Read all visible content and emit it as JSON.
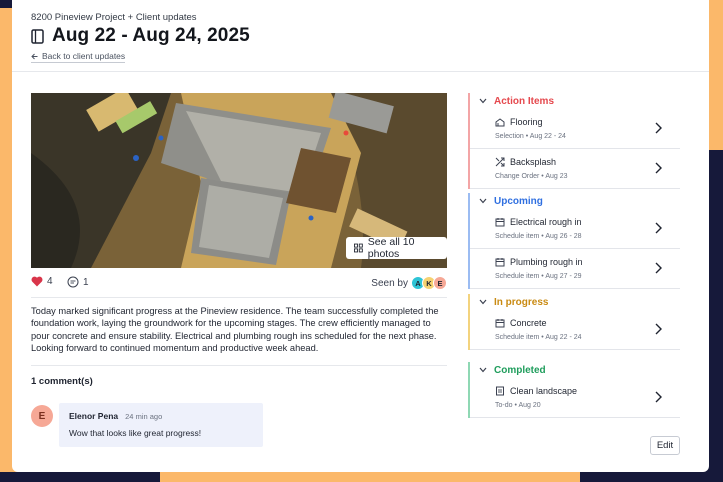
{
  "header": {
    "breadcrumb": "8200 Pineview Project + Client updates",
    "title": "Aug 22 - Aug 24, 2025",
    "back_link": "Back to client updates"
  },
  "photo": {
    "see_all_label": "See all 10 photos"
  },
  "reactions": {
    "likes": "4",
    "comments": "1",
    "seen_by_label": "Seen by",
    "avatars": [
      "A",
      "K",
      "E"
    ],
    "avatar_colors": [
      "#2ec4d6",
      "#f6d271",
      "#f6a896"
    ]
  },
  "description": "Today marked significant progress at the Pineview residence. The team successfully completed the foundation work, laying the groundwork for the upcoming stages. The crew efficiently managed to pour concrete and ensure stability. Electrical and plumbing rough ins scheduled for the next phase. Looking forward to continued momentum and productive week ahead.",
  "comments": {
    "title": "1 comment(s)",
    "items": [
      {
        "initial": "E",
        "author": "Elenor Pena",
        "time": "24 min ago",
        "text": "Wow that looks like great progress!"
      }
    ]
  },
  "sections": [
    {
      "title": "Action Items",
      "color": "#e5484d",
      "bar": "#f3a5a6",
      "items": [
        {
          "name": "Flooring",
          "icon": "selection-icon",
          "meta": "Selection • Aug 22 - 24"
        },
        {
          "name": "Backsplash",
          "icon": "change-order-icon",
          "meta": "Change Order • Aug 23"
        }
      ]
    },
    {
      "title": "Upcoming",
      "color": "#2f6fe0",
      "bar": "#9bbcf2",
      "items": [
        {
          "name": "Electrical rough in",
          "icon": "calendar-icon",
          "meta": "Schedule item • Aug 26 - 28"
        },
        {
          "name": "Plumbing rough in",
          "icon": "calendar-icon",
          "meta": "Schedule item • Aug 27 - 29"
        }
      ]
    },
    {
      "title": "In progress",
      "color": "#c98a12",
      "bar": "#f3d37e",
      "items": [
        {
          "name": "Concrete",
          "icon": "calendar-icon",
          "meta": "Schedule item • Aug 22 - 24"
        }
      ]
    },
    {
      "title": "Completed",
      "color": "#1f9d5c",
      "bar": "#8fd8b4",
      "items": [
        {
          "name": "Clean landscape",
          "icon": "todo-icon",
          "meta": "To-do • Aug 20"
        }
      ]
    }
  ],
  "edit_label": "Edit"
}
